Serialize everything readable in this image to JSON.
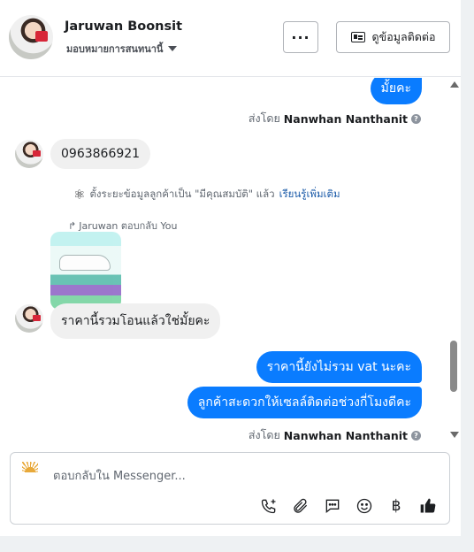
{
  "header": {
    "contact_name": "Jaruwan Boonsit",
    "assignee": "มอบหมายการสนทนานี้",
    "more_label": "···",
    "info_button": "ดูข้อมูลติดต่อ"
  },
  "thread": {
    "msg_out_1": "มั้ยคะ",
    "sent_by_1_prefix": "ส่งโดย",
    "sent_by_1_name": "Nanwhan Nanthanit",
    "msg_in_1": "0963866921",
    "notice_text": "ตั้งระยะข้อมูลลูกค้าเป็น \"มีคุณสมบัติ\" แล้ว",
    "notice_link": "เรียนรู้เพิ่มเติม",
    "replied_text": "Jaruwan ตอบกลับ You",
    "msg_in_2": "ราคานี้รวมโอนแล้วใช่มั้ยคะ",
    "msg_out_2": "ราคานี้ยังไม่รวม vat นะคะ",
    "msg_out_3": "ลูกค้าสะดวกให้เซลล์ติดต่อช่วงกี่โมงดีคะ",
    "sent_by_2_prefix": "ส่งโดย",
    "sent_by_2_name": "Nanwhan Nanthanit"
  },
  "composer": {
    "placeholder": "ตอบกลับใน Messenger...",
    "baht_symbol": "฿"
  },
  "colors": {
    "outgoing_bubble": "#0a7cff",
    "incoming_bubble": "#f0f0f0",
    "link": "#1a5aa8"
  },
  "icons": [
    "phone-add-icon",
    "paperclip-icon",
    "chat-bubble-icon",
    "smiley-icon",
    "baht-icon",
    "thumbs-up-icon"
  ]
}
